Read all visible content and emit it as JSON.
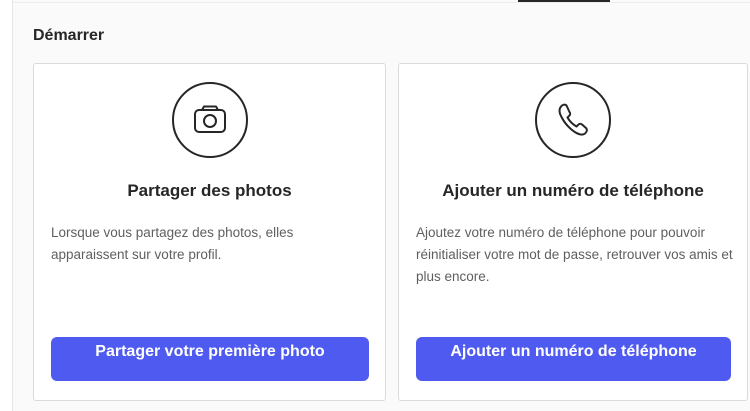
{
  "section": {
    "title": "Démarrer"
  },
  "cards": [
    {
      "icon": "camera-icon",
      "title": "Partager des photos",
      "description": "Lorsque vous partagez des photos, elles apparaissent sur votre profil.",
      "button_label": "Partager votre première photo"
    },
    {
      "icon": "phone-icon",
      "title": "Ajouter un numéro de téléphone",
      "description": "Ajoutez votre numéro de téléphone pour pouvoir réinitialiser votre mot de passe, retrouver vos amis et plus encore.",
      "button_label": "Ajouter un numéro de téléphone"
    }
  ],
  "colors": {
    "primary_button": "#4f5bf0",
    "title_text": "#262626",
    "body_text": "#5f5f5f"
  }
}
